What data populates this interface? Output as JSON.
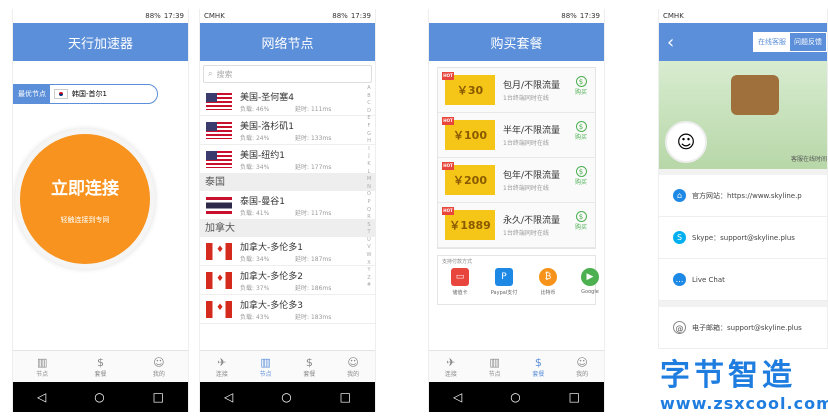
{
  "status": {
    "carrier": "CMHK",
    "time": "17:39",
    "battery": "88%"
  },
  "screen1": {
    "title": "天行加速器",
    "best_node_label": "最优节点",
    "selected_node": "韩国-首尔1",
    "connect_label": "立即连接",
    "connect_sub": "轻触连接到专网",
    "nav": [
      "节点",
      "套餐",
      "我的"
    ]
  },
  "screen2": {
    "title": "网络节点",
    "search_placeholder": "搜索",
    "load_prefix": "负载:",
    "timeout_prefix": "延时:",
    "groups": [
      {
        "name": "",
        "nodes": [
          {
            "name": "美国-圣何塞4",
            "load": "46%",
            "timeout": "111ms",
            "flag": "us"
          },
          {
            "name": "美国-洛杉矶1",
            "load": "24%",
            "timeout": "133ms",
            "flag": "us"
          },
          {
            "name": "美国-纽约1",
            "load": "34%",
            "timeout": "177ms",
            "flag": "us"
          }
        ]
      },
      {
        "name": "泰国",
        "nodes": [
          {
            "name": "泰国-曼谷1",
            "load": "41%",
            "timeout": "117ms",
            "flag": "th"
          }
        ]
      },
      {
        "name": "加拿大",
        "nodes": [
          {
            "name": "加拿大-多伦多1",
            "load": "34%",
            "timeout": "187ms",
            "flag": "ca"
          },
          {
            "name": "加拿大-多伦多2",
            "load": "37%",
            "timeout": "186ms",
            "flag": "ca"
          },
          {
            "name": "加拿大-多伦多3",
            "load": "43%",
            "timeout": "183ms",
            "flag": "ca"
          }
        ]
      }
    ],
    "index_letters": "A B C D E F G H I J K L M N O P Q R S T U V W X Y Z #",
    "nav": [
      "连接",
      "节点",
      "套餐",
      "我的"
    ]
  },
  "screen3": {
    "title": "购买套餐",
    "plans": [
      {
        "price": "30",
        "title": "包月/不限流量",
        "desc": "1台终端同时在线",
        "buy": "购买"
      },
      {
        "price": "100",
        "title": "半年/不限流量",
        "desc": "1台终端同时在线",
        "buy": "购买"
      },
      {
        "price": "200",
        "title": "包年/不限流量",
        "desc": "1台终端同时在线",
        "buy": "购买"
      },
      {
        "price": "1889",
        "title": "永久/不限流量",
        "desc": "1台终端同时在线",
        "buy": "购买"
      }
    ],
    "currency": "￥",
    "hot_tag": "HOT",
    "pay_title": "支持付款方式",
    "pay_methods": [
      "储值卡",
      "Paypal支付",
      "比特币",
      "Google"
    ],
    "nav": [
      "连接",
      "节点",
      "套餐",
      "我的"
    ]
  },
  "screen4": {
    "tabs": [
      "在线客服",
      "问题反馈"
    ],
    "avatar_text": "客服在线时间",
    "rows": [
      {
        "label": "官方网站：https://www.skyline.p"
      },
      {
        "label": "Skype：support@skyline.plus"
      },
      {
        "label": "Live Chat"
      },
      {
        "label": "电子邮箱：support@skyline.plus"
      }
    ]
  },
  "watermark": {
    "big": "字节智造",
    "small": "www.zsxcool.com"
  },
  "colors": {
    "primary": "#5b8fd9",
    "orange": "#f7931e",
    "gold": "#f5c518"
  }
}
